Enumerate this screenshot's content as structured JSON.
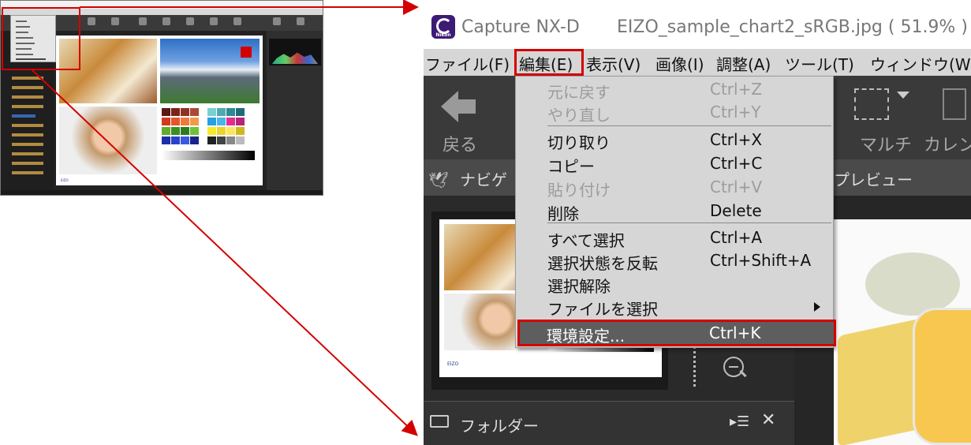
{
  "window": {
    "app_title": "Capture NX-D",
    "file_title": "EIZO_sample_chart2_sRGB.jpg ( 51.9% )",
    "logo_text": "Nikon"
  },
  "menubar": {
    "items": [
      {
        "label": "ファイル(F)"
      },
      {
        "label": "編集(E)"
      },
      {
        "label": "表示(V)"
      },
      {
        "label": "画像(I)"
      },
      {
        "label": "調整(A)"
      },
      {
        "label": "ツール(T)"
      },
      {
        "label": "ウィンドウ(W)"
      }
    ]
  },
  "toolbar": {
    "back_label": "戻る",
    "multi_label": "マルチ",
    "calendar_label": "カレン"
  },
  "panels": {
    "navigator_label": "ナビゲ",
    "preview_label": "プレビュー",
    "folder_label": "フォルダー",
    "folder_menu_glyph": "▸☰",
    "close_glyph": "✕"
  },
  "edit_menu": {
    "items": [
      {
        "label": "元に戻す",
        "shortcut": "Ctrl+Z",
        "enabled": false
      },
      {
        "label": "やり直し",
        "shortcut": "Ctrl+Y",
        "enabled": false
      },
      {
        "label": "切り取り",
        "shortcut": "Ctrl+X",
        "enabled": true
      },
      {
        "label": "コピー",
        "shortcut": "Ctrl+C",
        "enabled": true
      },
      {
        "label": "貼り付け",
        "shortcut": "Ctrl+V",
        "enabled": false
      },
      {
        "label": "削除",
        "shortcut": "Delete",
        "enabled": true
      },
      {
        "label": "すべて選択",
        "shortcut": "Ctrl+A",
        "enabled": true
      },
      {
        "label": "選択状態を反転",
        "shortcut": "Ctrl+Shift+A",
        "enabled": true
      },
      {
        "label": "選択解除",
        "shortcut": "",
        "enabled": true
      },
      {
        "label": "ファイルを選択",
        "shortcut": "",
        "enabled": true
      },
      {
        "label": "環境設定...",
        "shortcut": "Ctrl+K",
        "enabled": true
      }
    ]
  },
  "colors": {
    "highlight": "#d40000",
    "menu_bg": "#d6d6d6",
    "toolbar_bg": "#3a3a3a"
  },
  "icons": [
    "back-arrow-icon",
    "multi-view-icon",
    "calendar-icon",
    "bird-icon",
    "folder-icon",
    "zoom-out-icon",
    "submenu-arrow-icon"
  ]
}
